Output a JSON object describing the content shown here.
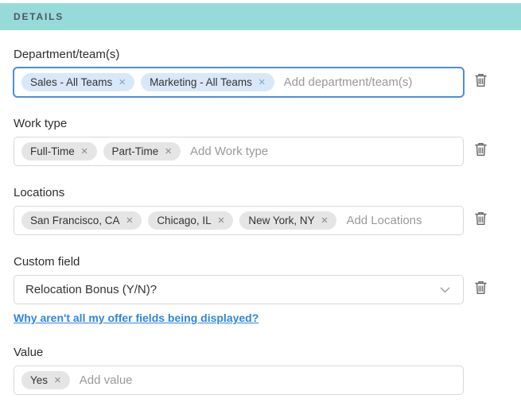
{
  "header": {
    "title": "DETAILS"
  },
  "colors": {
    "header_bg": "#97dbd8",
    "focus_border": "#4a8fdb",
    "tag_blue_bg": "#d9e8f8",
    "tag_gray_bg": "#e5e5e5",
    "link": "#2e86de"
  },
  "icons": {
    "remove_tag": "×",
    "trash": "trash-icon",
    "dropdown": "chevron-down-icon"
  },
  "fields": {
    "department": {
      "label": "Department/team(s)",
      "placeholder": "Add department/team(s)",
      "tags": [
        "Sales - All Teams",
        "Marketing - All Teams"
      ]
    },
    "work_type": {
      "label": "Work type",
      "placeholder": "Add Work type",
      "tags": [
        "Full-Time",
        "Part-Time"
      ]
    },
    "locations": {
      "label": "Locations",
      "placeholder": "Add Locations",
      "tags": [
        "San Francisco, CA",
        "Chicago, IL",
        "New York, NY"
      ]
    },
    "custom_field": {
      "label": "Custom field",
      "value": "Relocation Bonus (Y/N)?"
    },
    "value": {
      "label": "Value",
      "placeholder": "Add value",
      "tags": [
        "Yes"
      ]
    }
  },
  "link": {
    "text": "Why aren't all my offer fields being displayed?"
  }
}
